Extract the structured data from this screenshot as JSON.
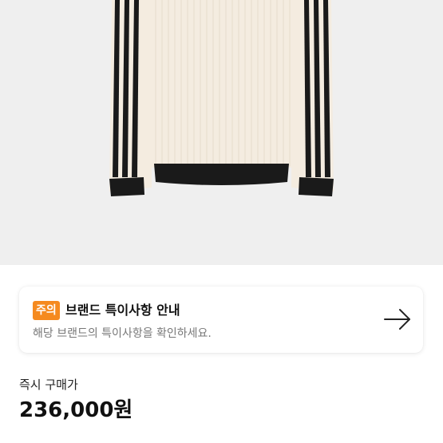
{
  "product": {
    "image_icon": "product-photo-sweater",
    "colors": {
      "body": "#f4ece0",
      "trim": "#1a1a1a",
      "background": "#efefef"
    }
  },
  "notice": {
    "badge": "주의",
    "title": "브랜드 특이사항 안내",
    "description": "해당 브랜드의 특이사항을 확인하세요.",
    "arrow_icon": "arrow-right-icon",
    "badge_color": "#f58a1f"
  },
  "price": {
    "label": "즉시 구매가",
    "value": "236,000원"
  }
}
